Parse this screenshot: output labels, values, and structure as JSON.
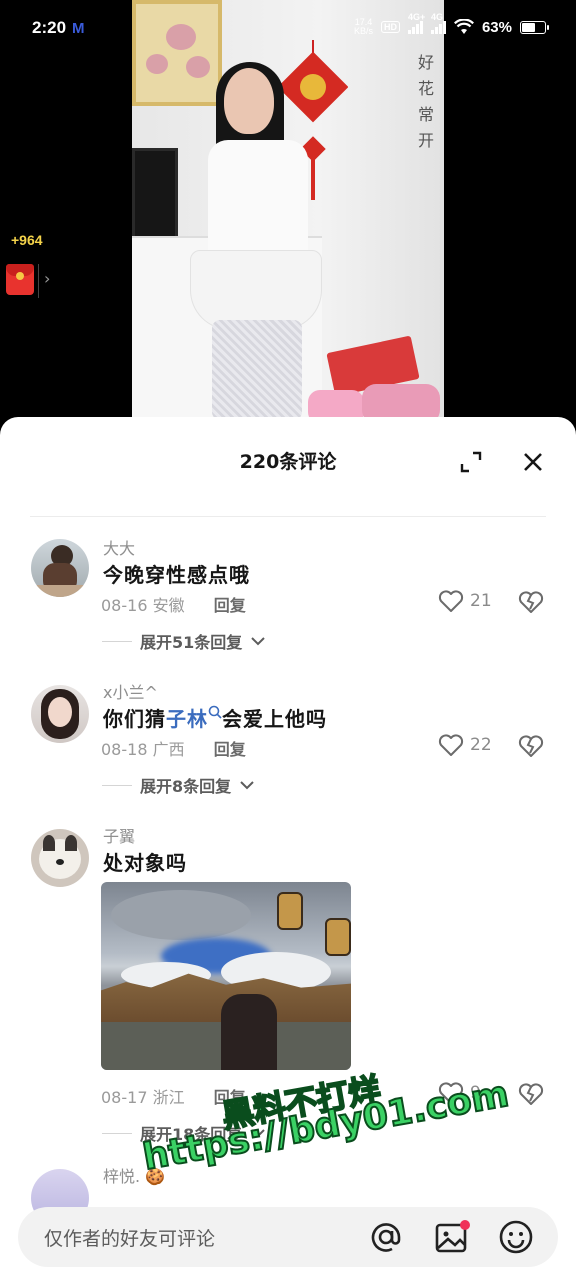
{
  "status_bar": {
    "time": "2:20",
    "carrier_logo": "M",
    "speed_value": "17.4",
    "speed_unit": "KB/s",
    "hd_label": "HD",
    "net1": "4G+",
    "net2": "4G",
    "battery": "63%",
    "battery_level": 0.63
  },
  "video": {
    "reward_count": "+964",
    "calligraphy": "好 花 常 开"
  },
  "panel": {
    "title": "220条评论"
  },
  "comments": [
    {
      "username": "大大",
      "text_parts": [
        {
          "text": "今晚穿性感点哦",
          "link": false
        }
      ],
      "date": "08-16",
      "location": "安徽",
      "reply_label": "回复",
      "likes": "21",
      "expand_label": "展开51条回复"
    },
    {
      "username": "x小兰^",
      "text_before": "你们猜",
      "text_link": "子林",
      "text_after": "会爱上他吗",
      "date": "08-18",
      "location": "广西",
      "reply_label": "回复",
      "likes": "22",
      "expand_label": "展开8条回复"
    },
    {
      "username": "子翼",
      "text": "处对象吗",
      "date": "08-17",
      "location": "浙江",
      "reply_label": "回复",
      "likes": "9",
      "expand_label": "展开18条回复"
    },
    {
      "username": "梓悦.",
      "emoji": "🍪"
    }
  ],
  "watermark": {
    "line1": "黑料不打烊",
    "line2": "https://bdy01.com"
  },
  "input_bar": {
    "placeholder": "仅作者的好友可评论"
  },
  "colors": {
    "link": "#3b6cbe",
    "reward": "#f4d34a",
    "watermark": "#3ad164"
  }
}
